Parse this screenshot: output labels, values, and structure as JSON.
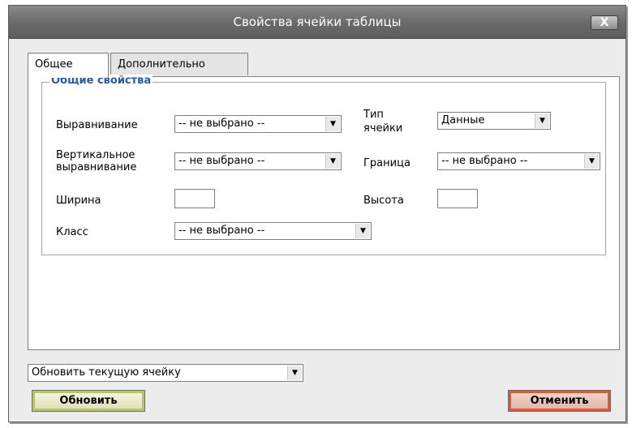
{
  "window": {
    "title": "Свойства ячейки таблицы",
    "close_label": "X"
  },
  "tabs": [
    {
      "label": "Общее",
      "active": true
    },
    {
      "label": "Дополнительно",
      "active": false
    }
  ],
  "general": {
    "legend": "Общие свойства",
    "align": {
      "label": "Выравнивание",
      "value": "-- не выбрано --"
    },
    "valign": {
      "label_line1": "Вертикальное",
      "label_line2": "выравнивание",
      "value": "-- не выбрано --"
    },
    "width": {
      "label": "Ширина",
      "value": ""
    },
    "class": {
      "label": "Класс",
      "value": "-- не выбрано --"
    },
    "cell_type": {
      "label_line1": "Тип",
      "label_line2": "ячейки",
      "value": "Данные"
    },
    "border": {
      "label": "Граница",
      "value": "-- не выбрано --"
    },
    "height": {
      "label": "Высота",
      "value": ""
    }
  },
  "footer": {
    "action_select": "Обновить текущую ячейку",
    "update_label": "Обновить",
    "cancel_label": "Отменить"
  },
  "icons": {
    "close": "close-icon",
    "dropdown": "chevron-down-icon"
  }
}
